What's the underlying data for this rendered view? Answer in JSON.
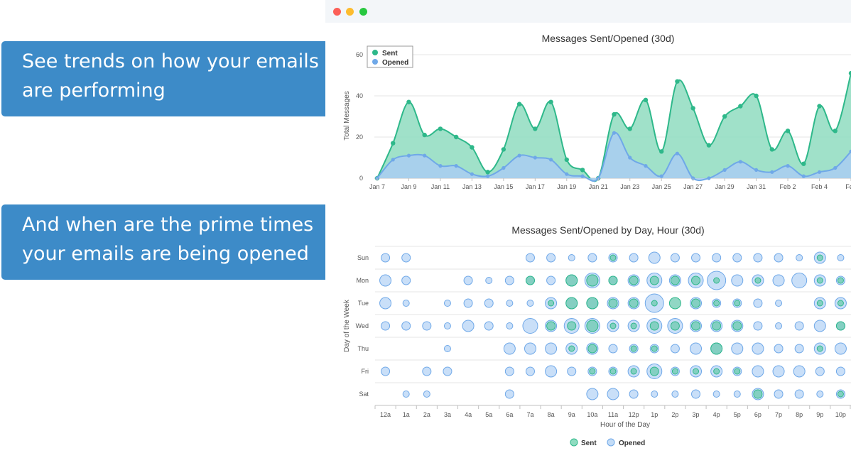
{
  "callouts": {
    "trends": {
      "line1": "See trends on how your emails",
      "line2": "are performing"
    },
    "prime": {
      "line1": "And when are the prime times",
      "line2": "your emails are being opened"
    }
  },
  "window": {
    "controls": [
      "close",
      "minimize",
      "maximize"
    ]
  },
  "colors": {
    "sent_line": "#2eb88a",
    "sent_fill": "#8fdcc0",
    "opened_line": "#6fa8e8",
    "opened_fill": "#a9cdf2",
    "callout_bg": "#3d8bc8"
  },
  "chart_data": [
    {
      "type": "area",
      "title": "Messages Sent/Opened (30d)",
      "ylabel": "Total Messages",
      "xlabel": "",
      "ylim": [
        0,
        60
      ],
      "yticks": [
        "0",
        "20",
        "40",
        "60"
      ],
      "x_tick_labels": [
        "Jan 7",
        "Jan 9",
        "Jan 11",
        "Jan 13",
        "Jan 15",
        "Jan 17",
        "Jan 19",
        "Jan 21",
        "Jan 23",
        "Jan 25",
        "Jan 27",
        "Jan 29",
        "Jan 31",
        "Feb 2",
        "Feb 4",
        "Feb"
      ],
      "legend_position": "top-left",
      "grid": true,
      "series": [
        {
          "name": "Sent",
          "values": [
            0,
            17,
            37,
            21,
            24,
            20,
            15,
            3,
            14,
            36,
            24,
            37,
            9,
            4,
            0,
            31,
            24,
            38,
            13,
            47,
            34,
            16,
            30,
            35,
            40,
            14,
            23,
            7,
            35,
            23,
            51
          ]
        },
        {
          "name": "Opened",
          "values": [
            0,
            9,
            11,
            11,
            6,
            6,
            2,
            1,
            5,
            11,
            10,
            9,
            2,
            1,
            0,
            22,
            10,
            6,
            1,
            12,
            0,
            0,
            4,
            8,
            4,
            3,
            6,
            1,
            3,
            5,
            13
          ]
        }
      ]
    },
    {
      "type": "scatter",
      "subtype": "bubble",
      "title": "Messages Sent/Opened by Day, Hour (30d)",
      "xlabel": "Hour of the Day",
      "ylabel": "Day of the Week",
      "days": [
        "Sun",
        "Mon",
        "Tue",
        "Wed",
        "Thu",
        "Fri",
        "Sat"
      ],
      "hours": [
        "12a",
        "1a",
        "2a",
        "3a",
        "4a",
        "5a",
        "6a",
        "7a",
        "8a",
        "9a",
        "10a",
        "11a",
        "12p",
        "1p",
        "2p",
        "3p",
        "4p",
        "5p",
        "6p",
        "7p",
        "8p",
        "9p",
        "10p"
      ],
      "legend": [
        "Sent",
        "Opened"
      ],
      "legend_position": "bottom-center",
      "series": [
        {
          "name": "Opened",
          "values": [
            [
              2,
              2,
              0,
              0,
              0,
              0,
              0,
              2,
              2,
              1,
              2,
              2,
              2,
              3,
              2,
              2,
              2,
              2,
              2,
              2,
              1,
              3,
              1
            ],
            [
              3,
              2,
              0,
              0,
              2,
              1,
              2,
              2,
              2,
              3,
              4,
              2,
              3,
              4,
              3,
              4,
              5,
              3,
              3,
              3,
              4,
              3,
              2
            ],
            [
              3,
              1,
              0,
              1,
              2,
              2,
              1,
              1,
              3,
              3,
              3,
              3,
              3,
              5,
              6,
              3,
              2,
              2,
              2,
              1,
              0,
              3,
              3
            ],
            [
              2,
              2,
              2,
              1,
              3,
              2,
              1,
              4,
              3,
              4,
              4,
              3,
              3,
              4,
              4,
              3,
              3,
              3,
              2,
              1,
              2,
              3,
              2
            ],
            [
              0,
              0,
              0,
              1,
              0,
              0,
              3,
              3,
              3,
              3,
              3,
              2,
              2,
              2,
              2,
              3,
              3,
              3,
              3,
              2,
              2,
              3,
              3
            ],
            [
              2,
              0,
              2,
              2,
              0,
              0,
              2,
              2,
              3,
              2,
              2,
              2,
              3,
              4,
              2,
              3,
              3,
              2,
              3,
              3,
              3,
              2,
              2
            ],
            [
              0,
              1,
              1,
              0,
              0,
              0,
              2,
              0,
              0,
              0,
              3,
              3,
              2,
              1,
              1,
              2,
              1,
              1,
              3,
              2,
              2,
              1,
              2
            ]
          ]
        },
        {
          "name": "Sent",
          "values": [
            [
              0,
              0,
              0,
              0,
              0,
              0,
              0,
              0,
              0,
              0,
              0,
              1,
              0,
              0,
              0,
              0,
              0,
              0,
              0,
              0,
              0,
              1,
              0
            ],
            [
              0,
              0,
              0,
              0,
              0,
              0,
              0,
              2,
              0,
              3,
              3,
              2,
              2,
              2,
              2,
              2,
              1,
              0,
              1,
              0,
              0,
              1,
              1
            ],
            [
              0,
              0,
              0,
              0,
              0,
              0,
              0,
              0,
              1,
              3,
              3,
              2,
              2,
              1,
              3,
              2,
              1,
              1,
              0,
              0,
              0,
              1,
              1
            ],
            [
              0,
              0,
              0,
              0,
              0,
              0,
              0,
              0,
              2,
              2,
              3,
              1,
              1,
              2,
              2,
              2,
              2,
              2,
              0,
              0,
              0,
              0,
              2
            ],
            [
              0,
              0,
              0,
              0,
              0,
              0,
              0,
              0,
              0,
              1,
              2,
              0,
              1,
              1,
              0,
              0,
              3,
              0,
              0,
              0,
              0,
              1,
              0
            ],
            [
              0,
              0,
              0,
              0,
              0,
              0,
              0,
              0,
              0,
              0,
              1,
              1,
              1,
              2,
              1,
              1,
              1,
              1,
              0,
              0,
              0,
              0,
              0
            ],
            [
              0,
              0,
              0,
              0,
              0,
              0,
              0,
              0,
              0,
              0,
              0,
              0,
              0,
              0,
              0,
              0,
              0,
              0,
              2,
              0,
              0,
              0,
              1
            ]
          ]
        }
      ]
    }
  ]
}
